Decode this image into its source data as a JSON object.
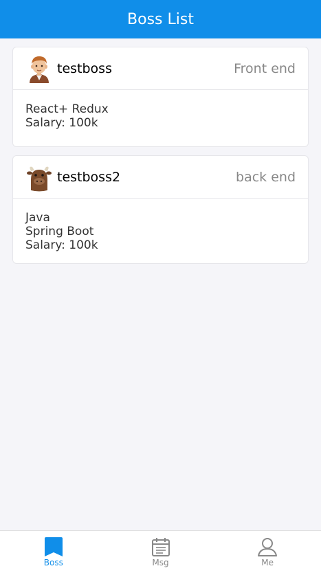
{
  "header": {
    "title": "Boss List"
  },
  "cards": [
    {
      "name": "testboss",
      "position": "Front end",
      "avatar_icon": "man-avatar",
      "description": [
        "React+ Redux"
      ],
      "salary": "Salary: 100k"
    },
    {
      "name": "testboss2",
      "position": "back end",
      "avatar_icon": "cow-avatar",
      "description": [
        "Java",
        "Spring Boot"
      ],
      "salary": "Salary: 100k"
    }
  ],
  "tabs": [
    {
      "label": "Boss",
      "icon": "bookmark-icon",
      "active": true
    },
    {
      "label": "Msg",
      "icon": "calendar-icon",
      "active": false
    },
    {
      "label": "Me",
      "icon": "user-icon",
      "active": false
    }
  ],
  "colors": {
    "primary": "#108ee9",
    "background": "#f5f5f9",
    "inactive": "#888888"
  }
}
